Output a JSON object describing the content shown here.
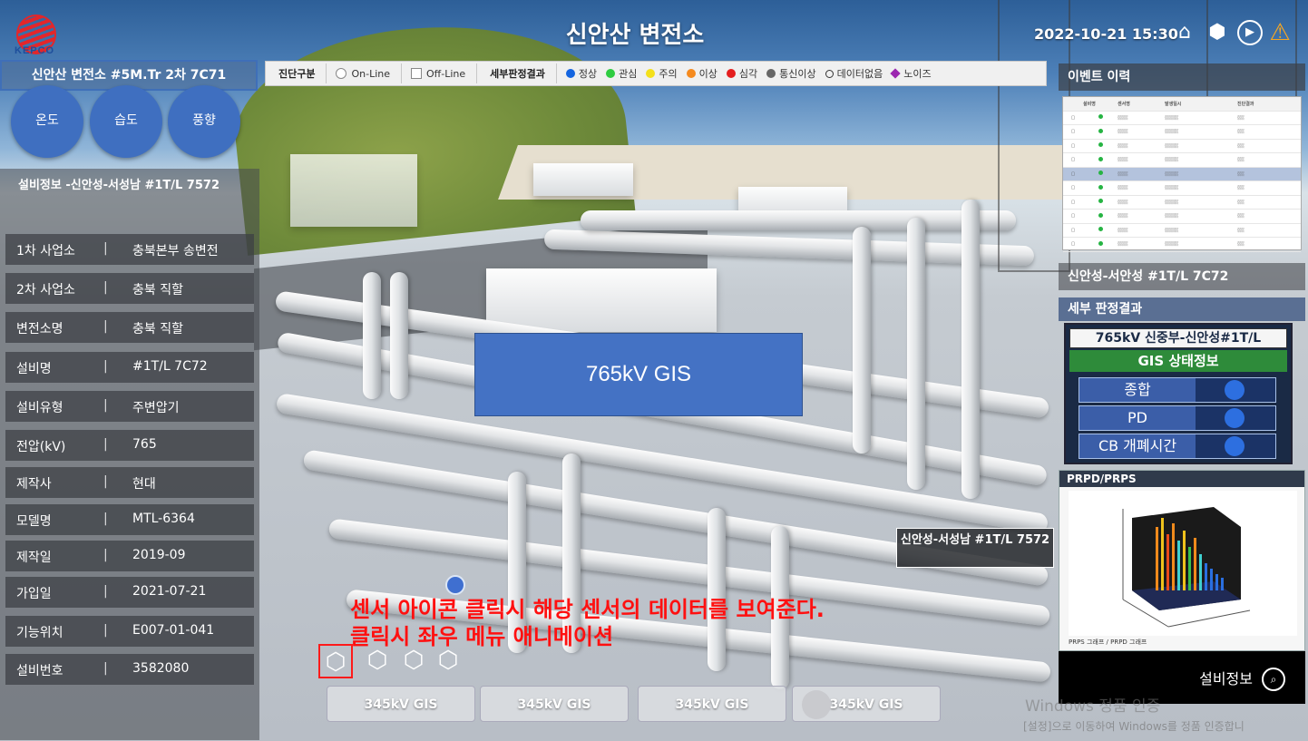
{
  "header": {
    "title": "신안산 변전소",
    "datetime": "2022-10-21 15:30",
    "logo_text": "KEPCO"
  },
  "station_label": "신안산 변전소 #5M.Tr 2차 7C71",
  "sensor_buttons": [
    "온도",
    "습도",
    "풍향"
  ],
  "equipment": {
    "title": "설비정보 -신안성-서성남 #1T/L 7572",
    "rows": [
      {
        "key": "1차 사업소",
        "sep": "|",
        "value": "충북본부 송변전"
      },
      {
        "key": "2차 사업소",
        "sep": "|",
        "value": "충북 직할"
      },
      {
        "key": "변전소명",
        "sep": "|",
        "value": "충북 직할"
      },
      {
        "key": "설비명",
        "sep": "|",
        "value": "#1T/L 7C72"
      },
      {
        "key": "설비유형",
        "sep": "|",
        "value": "주변압기"
      },
      {
        "key": "전압(kV)",
        "sep": "|",
        "value": "765"
      },
      {
        "key": "제작사",
        "sep": "|",
        "value": "현대"
      },
      {
        "key": "모델명",
        "sep": "|",
        "value": "MTL-6364"
      },
      {
        "key": "제작일",
        "sep": "|",
        "value": "2019-09"
      },
      {
        "key": "가입일",
        "sep": "|",
        "value": "2021-07-21"
      },
      {
        "key": "기능위치",
        "sep": "|",
        "value": "E007-01-041"
      },
      {
        "key": "설비번호",
        "sep": "|",
        "value": "3582080"
      }
    ]
  },
  "filter": {
    "diag_label": "진단구분",
    "online": "On-Line",
    "offline": "Off-Line",
    "result_label": "세부판정결과",
    "legend": [
      {
        "label": "정상",
        "color": "#1565e0"
      },
      {
        "label": "관심",
        "color": "#2ecc40"
      },
      {
        "label": "주의",
        "color": "#f4e01a"
      },
      {
        "label": "이상",
        "color": "#f58a1e"
      },
      {
        "label": "심각",
        "color": "#e41e1e"
      },
      {
        "label": "통신이상",
        "color": "#666666"
      },
      {
        "label": "데이터없음",
        "color": "ring"
      },
      {
        "label": "노이즈",
        "color": "#9c27b0"
      }
    ]
  },
  "scene": {
    "gis_label": "765kV GIS",
    "popup_label": "신안성-서성남 #1T/L 7572",
    "annotation_1": "센서 아이콘 클릭시 해당 센서의 데이터를 보여준다.",
    "annotation_2": "클릭시 좌우 메뉴 애니메이션",
    "gis_buttons": [
      "345kV GIS",
      "345kV GIS",
      "345kV GIS",
      "345kV GIS"
    ]
  },
  "right": {
    "event_title": "이벤트 이력",
    "event_table": {
      "headers": [
        "",
        "설비명",
        "센서명",
        "발생일시",
        "진단결과"
      ],
      "rows": [
        {
          "sel": false
        },
        {
          "sel": false
        },
        {
          "sel": false
        },
        {
          "sel": false
        },
        {
          "sel": true
        },
        {
          "sel": false
        },
        {
          "sel": false
        },
        {
          "sel": false
        },
        {
          "sel": false
        },
        {
          "sel": false
        }
      ]
    },
    "equip_name": "신안성-서안성 #1T/L 7C72",
    "detail_title": "세부 판정결과",
    "status_title": "765kV 신중부-신안성#1T/L",
    "status_sub": "GIS 상태정보",
    "status_rows": [
      "종합",
      "PD",
      "CB 개폐시간"
    ],
    "prpd_title": "PRPD/PRPS",
    "prpd_tabs": "PRPS 그래프 / PRPD 그래프",
    "equip_info_label": "설비정보"
  },
  "watermark": {
    "line1": "Windows 정품 인증",
    "line2": "[설정]으로 이동하여 Windows를 정품 인증합니"
  }
}
